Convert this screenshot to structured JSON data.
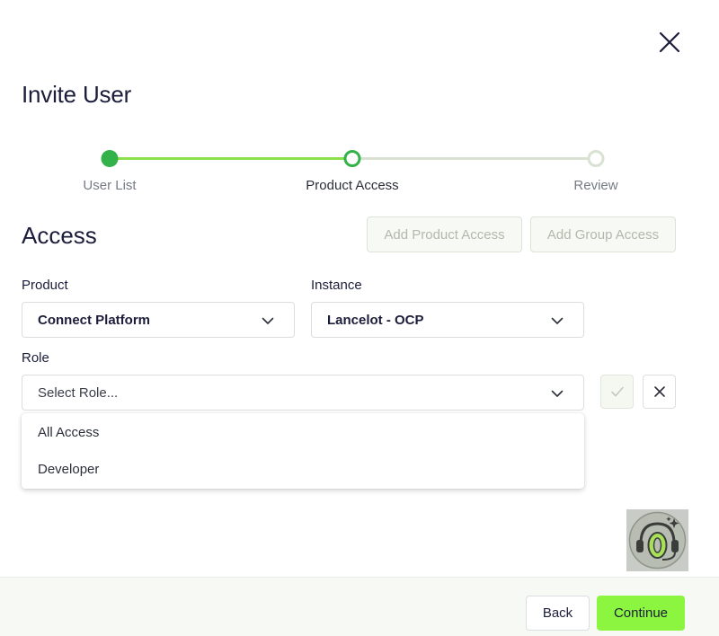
{
  "dialog": {
    "title": "Invite User",
    "close_icon": "close-icon"
  },
  "stepper": {
    "steps": [
      {
        "label": "User List",
        "state": "complete"
      },
      {
        "label": "Product Access",
        "state": "current"
      },
      {
        "label": "Review",
        "state": "pending"
      }
    ],
    "colors": {
      "complete": "#34b24a",
      "progress": "#8be04a",
      "pending": "#d9e2d2"
    }
  },
  "access": {
    "title": "Access",
    "add_product_access_label": "Add Product Access",
    "add_group_access_label": "Add Group Access"
  },
  "form": {
    "product": {
      "label": "Product",
      "value": "Connect Platform"
    },
    "instance": {
      "label": "Instance",
      "value": "Lancelot - OCP"
    },
    "role": {
      "label": "Role",
      "placeholder": "Select Role...",
      "options": [
        "All Access",
        "Developer"
      ]
    },
    "confirm_icon": "check-icon",
    "cancel_icon": "close-icon"
  },
  "help": {
    "icon": "support-headset-icon"
  },
  "footer": {
    "back_label": "Back",
    "continue_label": "Continue",
    "accent_color": "#8cf53f"
  }
}
